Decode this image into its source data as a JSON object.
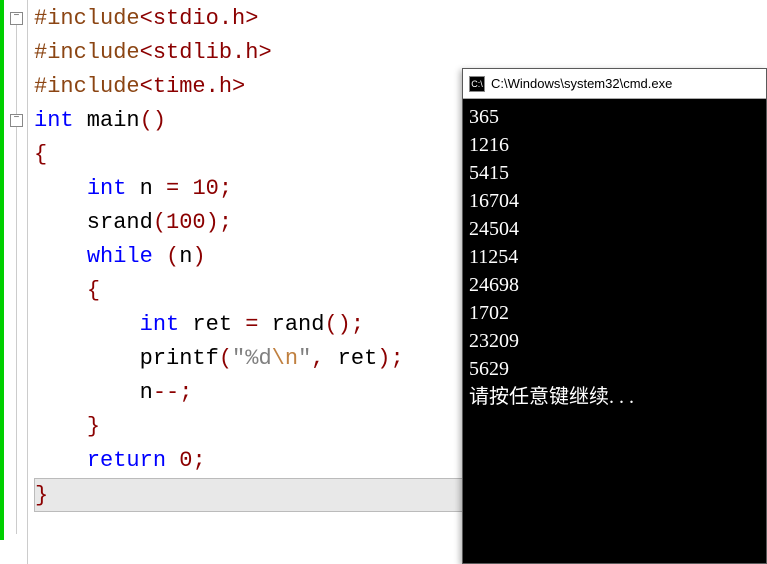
{
  "editor": {
    "fold_marks": [
      {
        "line": 0
      },
      {
        "line": 3
      }
    ],
    "lines": [
      {
        "tokens": [
          {
            "t": "#include",
            "c": "kw-preproc"
          },
          {
            "t": "<stdio.h>",
            "c": "kw-red"
          }
        ]
      },
      {
        "tokens": [
          {
            "t": "#include",
            "c": "kw-preproc"
          },
          {
            "t": "<stdlib.h>",
            "c": "kw-red"
          }
        ]
      },
      {
        "tokens": [
          {
            "t": "#include",
            "c": "kw-preproc"
          },
          {
            "t": "<time.h>",
            "c": "kw-red"
          }
        ]
      },
      {
        "tokens": [
          {
            "t": "int",
            "c": "kw-blue"
          },
          {
            "t": " main",
            "c": "kw-black"
          },
          {
            "t": "()",
            "c": "kw-red"
          }
        ]
      },
      {
        "tokens": [
          {
            "t": "{",
            "c": "kw-red"
          }
        ]
      },
      {
        "tokens": [
          {
            "t": "    ",
            "c": ""
          },
          {
            "t": "int",
            "c": "kw-blue"
          },
          {
            "t": " n ",
            "c": "kw-black"
          },
          {
            "t": "=",
            "c": "kw-red"
          },
          {
            "t": " ",
            "c": ""
          },
          {
            "t": "10",
            "c": "kw-red"
          },
          {
            "t": ";",
            "c": "kw-red"
          }
        ]
      },
      {
        "tokens": [
          {
            "t": "    srand",
            "c": "kw-black"
          },
          {
            "t": "(",
            "c": "kw-red"
          },
          {
            "t": "100",
            "c": "kw-red"
          },
          {
            "t": ");",
            "c": "kw-red"
          }
        ]
      },
      {
        "tokens": [
          {
            "t": "    ",
            "c": ""
          },
          {
            "t": "while",
            "c": "kw-blue"
          },
          {
            "t": " ",
            "c": ""
          },
          {
            "t": "(",
            "c": "kw-red"
          },
          {
            "t": "n",
            "c": "kw-black"
          },
          {
            "t": ")",
            "c": "kw-red"
          }
        ]
      },
      {
        "tokens": [
          {
            "t": "    ",
            "c": ""
          },
          {
            "t": "{",
            "c": "kw-red"
          }
        ]
      },
      {
        "tokens": [
          {
            "t": "        ",
            "c": ""
          },
          {
            "t": "int",
            "c": "kw-blue"
          },
          {
            "t": " ret ",
            "c": "kw-black"
          },
          {
            "t": "=",
            "c": "kw-red"
          },
          {
            "t": " rand",
            "c": "kw-black"
          },
          {
            "t": "();",
            "c": "kw-red"
          }
        ]
      },
      {
        "tokens": [
          {
            "t": "        printf",
            "c": "kw-black"
          },
          {
            "t": "(",
            "c": "kw-red"
          },
          {
            "t": "\"%d",
            "c": "kw-string"
          },
          {
            "t": "\\n",
            "c": "kw-escape"
          },
          {
            "t": "\"",
            "c": "kw-string"
          },
          {
            "t": ",",
            "c": "kw-red"
          },
          {
            "t": " ret",
            "c": "kw-black"
          },
          {
            "t": ");",
            "c": "kw-red"
          }
        ]
      },
      {
        "tokens": [
          {
            "t": "        n",
            "c": "kw-black"
          },
          {
            "t": "--;",
            "c": "kw-red"
          }
        ]
      },
      {
        "tokens": [
          {
            "t": "    ",
            "c": ""
          },
          {
            "t": "}",
            "c": "kw-red"
          }
        ]
      },
      {
        "tokens": [
          {
            "t": "    ",
            "c": ""
          },
          {
            "t": "return",
            "c": "kw-blue"
          },
          {
            "t": " ",
            "c": ""
          },
          {
            "t": "0",
            "c": "kw-red"
          },
          {
            "t": ";",
            "c": "kw-red"
          }
        ]
      },
      {
        "tokens": [
          {
            "t": "}",
            "c": "kw-red"
          }
        ],
        "highlight": true
      }
    ]
  },
  "console": {
    "title": "C:\\Windows\\system32\\cmd.exe",
    "icon_text": "C:\\",
    "output": [
      "365",
      "1216",
      "5415",
      "16704",
      "24504",
      "11254",
      "24698",
      "1702",
      "23209",
      "5629",
      "请按任意键继续. . ."
    ]
  }
}
